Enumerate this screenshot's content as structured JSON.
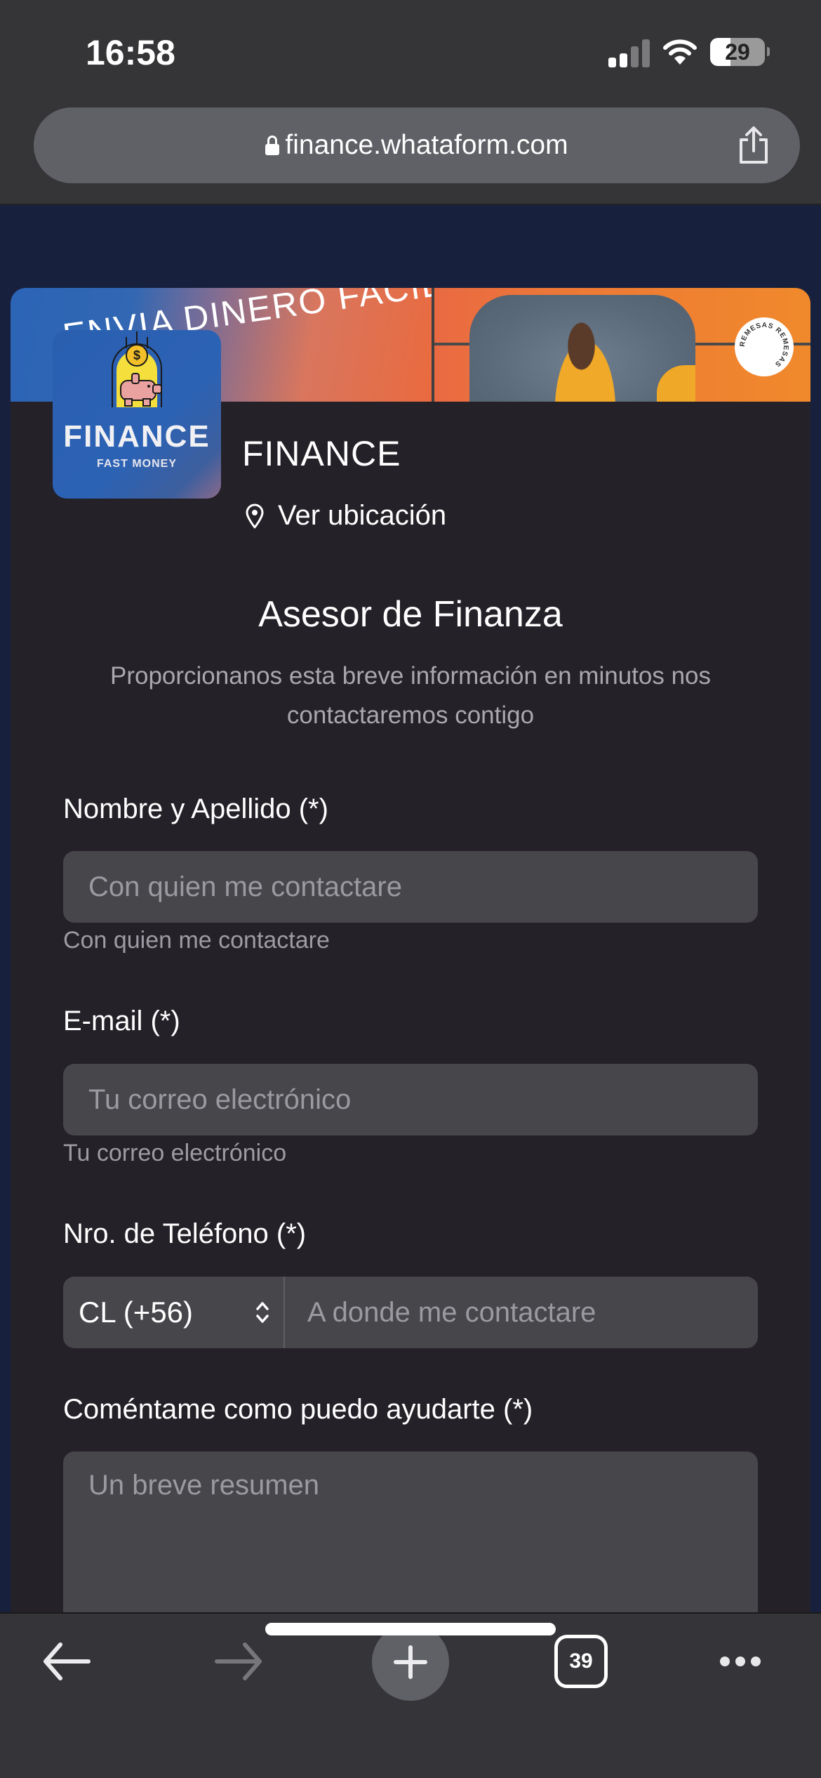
{
  "status_bar": {
    "time": "16:58",
    "signal_icon": "cellular-signal-icon",
    "wifi_icon": "wifi-icon",
    "battery_level": "29"
  },
  "browser": {
    "url": "finance.whataform.com",
    "lock_icon": "lock-icon",
    "share_icon": "share-icon",
    "toolbar": {
      "back_icon": "arrow-left-icon",
      "forward_icon": "arrow-right-icon",
      "new_tab_icon": "plus-icon",
      "tab_count": "39",
      "more_icon": "ellipsis-icon"
    }
  },
  "banner": {
    "headline": "ENVIA DINERO FACIL",
    "badge_text": "REMESAS REMESAS"
  },
  "business": {
    "logo_title": "FINANCE",
    "logo_subtitle": "FAST MONEY",
    "name": "FINANCE",
    "location_label": "Ver ubicación"
  },
  "form": {
    "title": "Asesor de Finanza",
    "description": "Proporcionanos esta breve información en minutos nos contactaremos contigo",
    "fields": {
      "name": {
        "label": "Nombre y Apellido (*)",
        "placeholder": "Con quien me contactare",
        "value": "",
        "helper": "Con quien me contactare"
      },
      "email": {
        "label": "E-mail (*)",
        "placeholder": "Tu correo electrónico",
        "value": "",
        "helper": "Tu correo electrónico"
      },
      "phone": {
        "label": "Nro. de Teléfono (*)",
        "country_code": "CL (+56)",
        "placeholder": "A donde me contactare",
        "value": ""
      },
      "comment": {
        "label": "Coméntame como puedo ayudarte (*)",
        "placeholder": "Un breve resumen",
        "value": ""
      }
    }
  }
}
